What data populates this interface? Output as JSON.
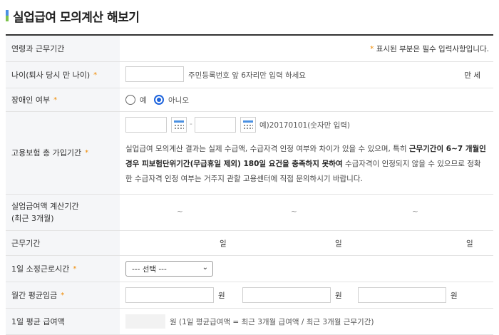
{
  "page_title": "실업급여 모의계산 해보기",
  "header": {
    "label": "연령과 근무기간",
    "required_note": "표시된 부분은 필수 입력사항입니다.",
    "required_mark": "*"
  },
  "age": {
    "label": "나이(퇴사 당시 만 나이)",
    "value": "",
    "hint": "주민등록번호 앞 6자리만 입력 하세요",
    "unit": "만 세"
  },
  "disability": {
    "label": "장애인 여부",
    "options": [
      "예",
      "아니오"
    ],
    "selected": "아니오"
  },
  "insurance_period": {
    "label": "고용보험 총 가입기간",
    "start_value": "",
    "end_value": "",
    "separator": "-",
    "example": "예)20170101(숫자만 입력)",
    "notice_part1": "실업급여 모의계산 결과는 실제 수급액, 수급자격 인정 여부와 차이가 있을 수 있으며, 특히 ",
    "notice_bold": "근무기간이 6~7 개월인 경우 피보험단위기간(무급휴일 제외) 180일 요건을 충족하지 못하여",
    "notice_part2": " 수급자격이 인정되지 않을 수 있으므로 정확한 수급자격 인정 여부는 거주지 관할 고용센터에 직접 문의하시기 바랍니다."
  },
  "calc_period": {
    "label_line1": "실업급여액 계산기간",
    "label_line2": "(최근 3개월)",
    "cols": [
      "~",
      "~",
      "~"
    ]
  },
  "work_days": {
    "label": "근무기간",
    "unit": "일"
  },
  "daily_hours": {
    "label": "1일 소정근로시간",
    "selected": "--- 선택 ---"
  },
  "monthly_wage": {
    "label": "월간 평균임금",
    "unit": "원"
  },
  "daily_avg": {
    "label": "1일 평균 급여액",
    "formula": "원 (1일 평균급여액 = 최근 3개월 급여액 / 최근 3개월 근무기간)"
  }
}
